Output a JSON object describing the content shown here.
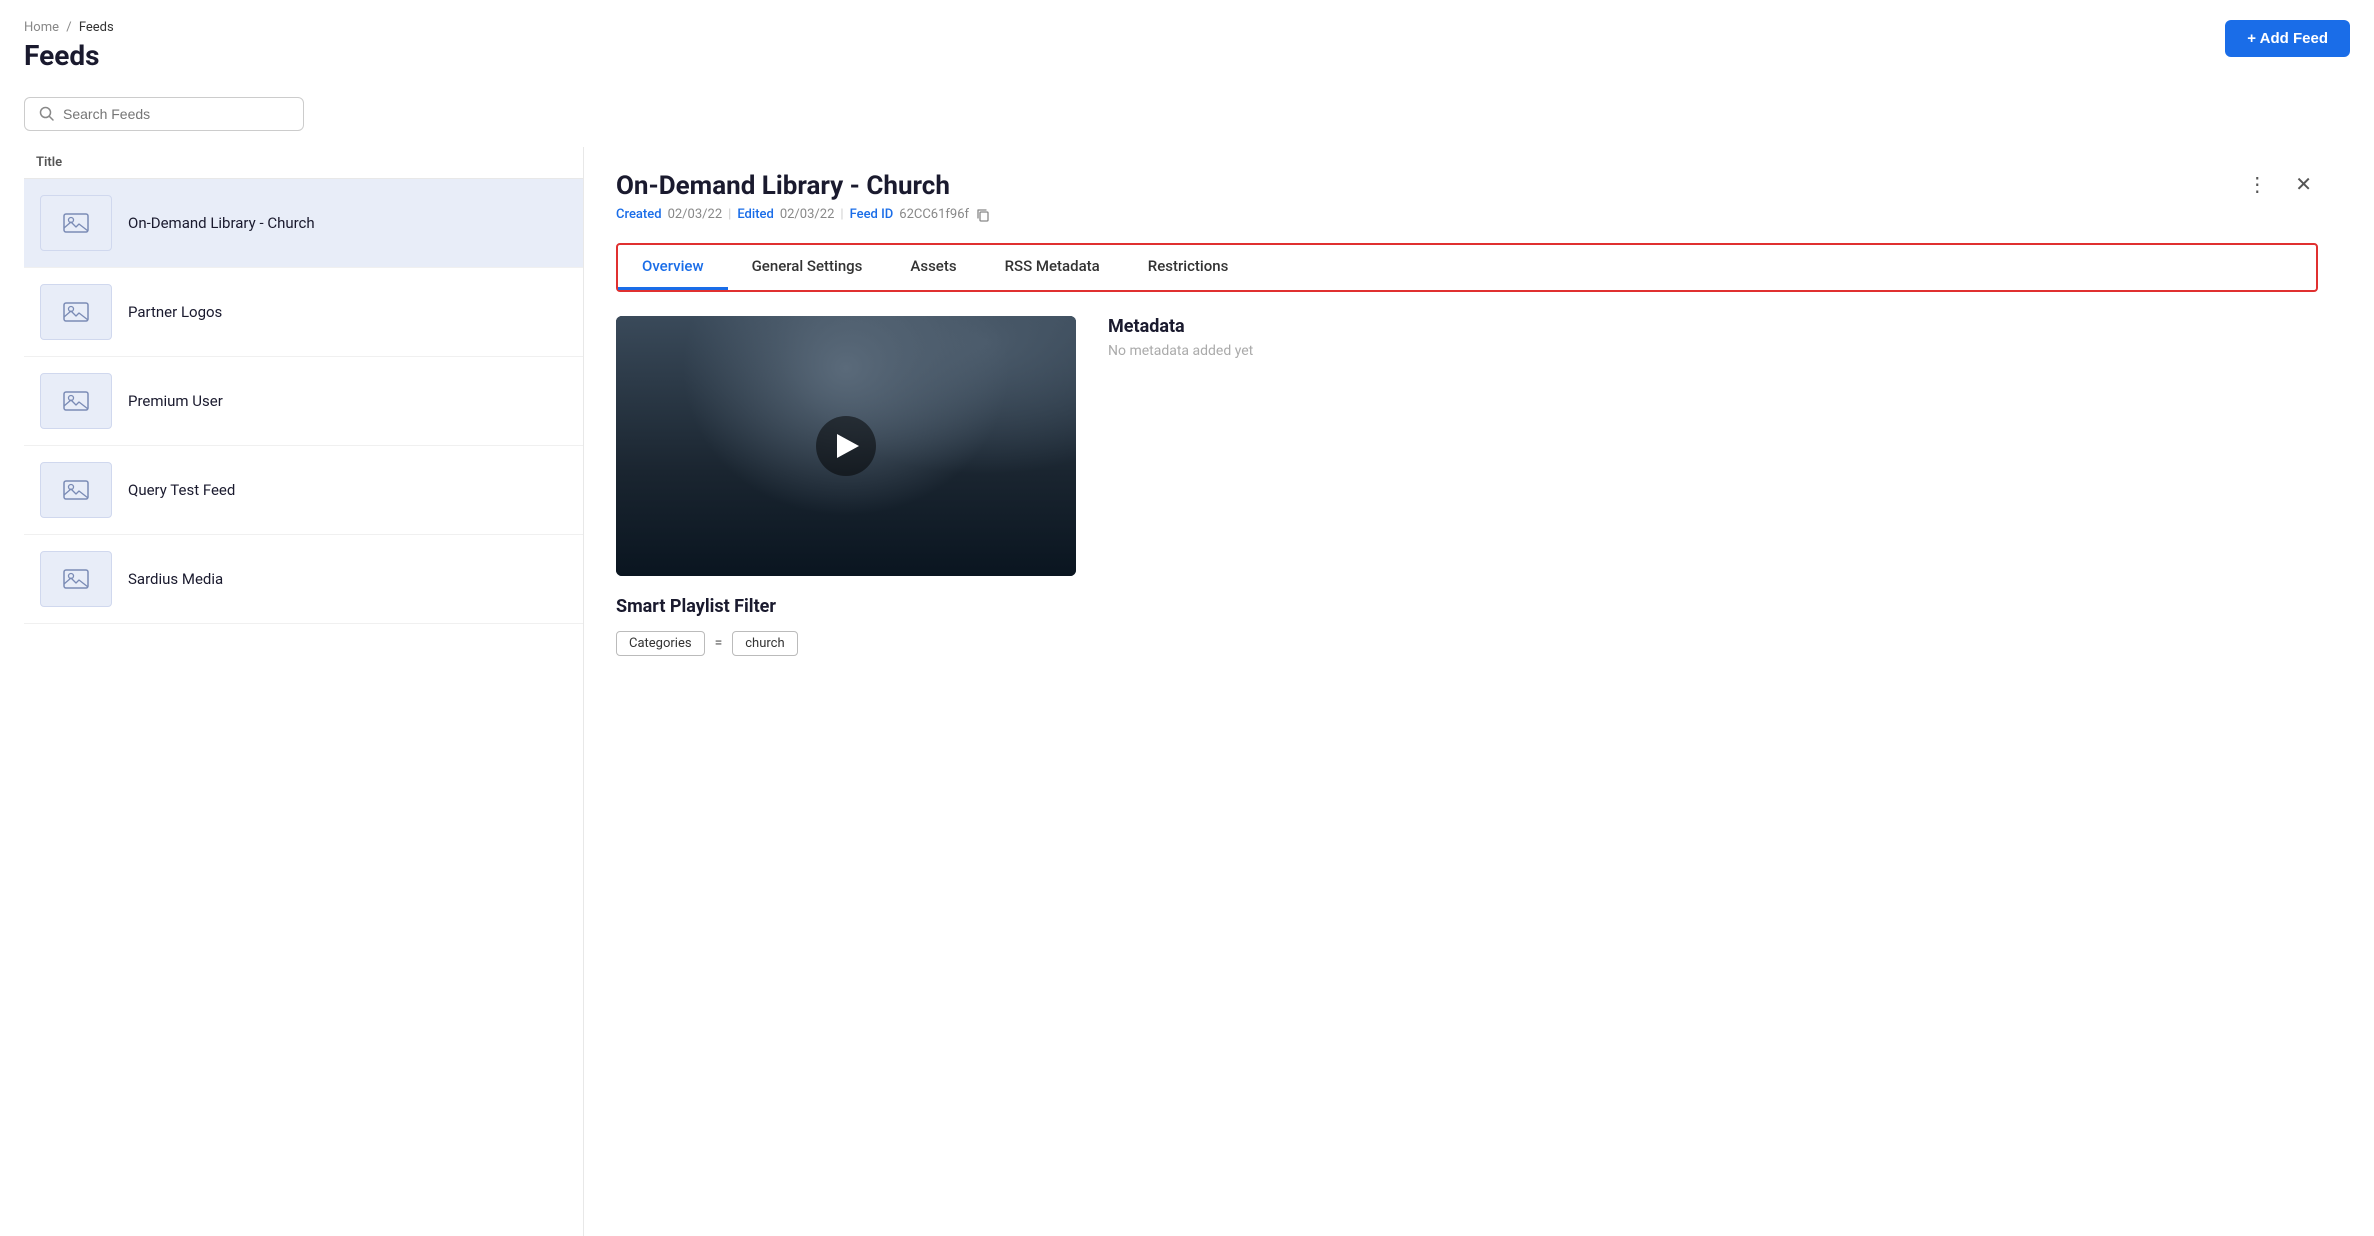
{
  "breadcrumb": {
    "home": "Home",
    "separator": "/",
    "current": "Feeds"
  },
  "page": {
    "title": "Feeds"
  },
  "header": {
    "add_button_label": "+ Add Feed"
  },
  "search": {
    "placeholder": "Search Feeds"
  },
  "feed_list": {
    "column_title": "Title",
    "items": [
      {
        "id": 1,
        "title": "On-Demand Library - Church",
        "active": true
      },
      {
        "id": 2,
        "title": "Partner Logos",
        "active": false
      },
      {
        "id": 3,
        "title": "Premium User",
        "active": false
      },
      {
        "id": 4,
        "title": "Query Test Feed",
        "active": false
      },
      {
        "id": 5,
        "title": "Sardius Media",
        "active": false
      }
    ]
  },
  "detail": {
    "title": "On-Demand Library - Church",
    "meta": {
      "created_label": "Created",
      "created_value": "02/03/22",
      "edited_label": "Edited",
      "edited_value": "02/03/22",
      "feed_id_label": "Feed ID",
      "feed_id_value": "62CC61f96f"
    },
    "tabs": [
      {
        "id": "overview",
        "label": "Overview",
        "active": true
      },
      {
        "id": "general-settings",
        "label": "General Settings",
        "active": false
      },
      {
        "id": "assets",
        "label": "Assets",
        "active": false
      },
      {
        "id": "rss-metadata",
        "label": "RSS Metadata",
        "active": false
      },
      {
        "id": "restrictions",
        "label": "Restrictions",
        "active": false
      }
    ],
    "overview": {
      "metadata": {
        "title": "Metadata",
        "empty_text": "No metadata added yet"
      },
      "playlist": {
        "title": "Smart Playlist Filter",
        "filter_key": "Categories",
        "filter_operator": "=",
        "filter_value": "church"
      }
    }
  }
}
